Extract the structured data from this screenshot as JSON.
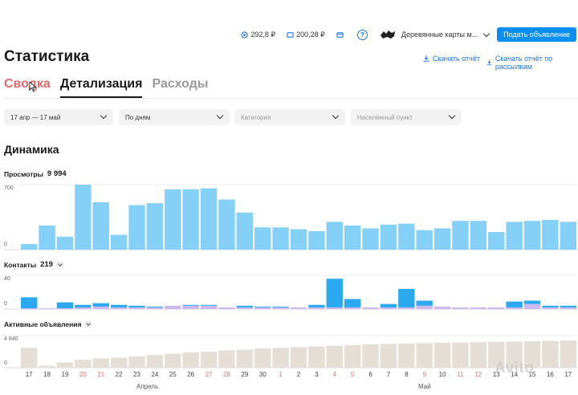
{
  "topbar": {
    "balance1": "292,8 ₽",
    "balance2": "200,28 ₽",
    "help": "?",
    "account_name": "Деревянные карты м...",
    "post_ad_label": "Подать объявление"
  },
  "page": {
    "title": "Статистика",
    "download_report": "Скачать отчёт",
    "download_report_mail": "Скачать отчёт по рассылкам",
    "tabs": [
      "Сводка",
      "Детализация",
      "Расходы"
    ]
  },
  "filters": {
    "date_range": "17 апр — 17 май",
    "grouping": "По дням",
    "category_placeholder": "Категория",
    "city_placeholder": "Населённый пункт"
  },
  "dynamics": {
    "title": "Динамика",
    "views_label": "Просмотры",
    "views_total": "9 994",
    "contacts_label": "Контакты",
    "contacts_total": "219",
    "active_label": "Активные объявления"
  },
  "chart_data": [
    {
      "type": "bar",
      "name": "views",
      "categories": [
        "17",
        "18",
        "19",
        "20",
        "21",
        "22",
        "23",
        "24",
        "25",
        "26",
        "27",
        "28",
        "29",
        "30",
        "1",
        "2",
        "3",
        "4",
        "5",
        "6",
        "7",
        "8",
        "9",
        "10",
        "11",
        "12",
        "13",
        "14",
        "15",
        "16",
        "17"
      ],
      "weekend_flags": [
        false,
        false,
        false,
        true,
        true,
        false,
        false,
        false,
        false,
        false,
        true,
        true,
        false,
        false,
        true,
        false,
        false,
        true,
        true,
        false,
        false,
        false,
        true,
        false,
        true,
        true,
        false,
        false,
        false,
        false,
        false
      ],
      "values": [
        60,
        260,
        140,
        700,
        510,
        160,
        480,
        500,
        650,
        650,
        660,
        540,
        400,
        240,
        240,
        220,
        200,
        300,
        260,
        230,
        270,
        280,
        210,
        230,
        310,
        310,
        190,
        300,
        310,
        320,
        300
      ],
      "ylim": [
        0,
        700
      ],
      "yticks": [
        "700",
        "0"
      ],
      "color": "#84d0f6"
    },
    {
      "type": "bar",
      "name": "contacts",
      "categories": [
        "17",
        "18",
        "19",
        "20",
        "21",
        "22",
        "23",
        "24",
        "25",
        "26",
        "27",
        "28",
        "29",
        "30",
        "1",
        "2",
        "3",
        "4",
        "5",
        "6",
        "7",
        "8",
        "9",
        "10",
        "11",
        "12",
        "13",
        "14",
        "15",
        "16",
        "17"
      ],
      "values": [
        13,
        0,
        7,
        3,
        4,
        3,
        2,
        1,
        0,
        1,
        1,
        0,
        2,
        1,
        1,
        0,
        3,
        34,
        10,
        0,
        4,
        22,
        6,
        0,
        0,
        0,
        0,
        7,
        4,
        2,
        2
      ],
      "secondary_values": [
        1,
        1,
        1,
        2,
        3,
        2,
        2,
        2,
        4,
        4,
        4,
        2,
        2,
        2,
        2,
        2,
        2,
        2,
        2,
        2,
        2,
        2,
        4,
        3,
        2,
        2,
        2,
        2,
        6,
        2,
        2
      ],
      "ylim": [
        0,
        40
      ],
      "yticks": [
        "40",
        "0"
      ],
      "colors": [
        "#2ba9f0",
        "#cbb8f0"
      ]
    },
    {
      "type": "bar",
      "name": "active_ads",
      "categories": [
        "17",
        "18",
        "19",
        "20",
        "21",
        "22",
        "23",
        "24",
        "25",
        "26",
        "27",
        "28",
        "29",
        "30",
        "1",
        "2",
        "3",
        "4",
        "5",
        "6",
        "7",
        "8",
        "9",
        "10",
        "11",
        "12",
        "13",
        "14",
        "15",
        "16",
        "17"
      ],
      "values": [
        3000,
        300,
        800,
        1200,
        1400,
        1500,
        1700,
        1900,
        2100,
        2300,
        2400,
        2600,
        2700,
        2900,
        3000,
        3100,
        3200,
        3300,
        3400,
        3500,
        3600,
        3650,
        3700,
        3750,
        3800,
        3850,
        3900,
        3950,
        4000,
        4050,
        4100
      ],
      "ylim": [
        0,
        4840
      ],
      "yticks": [
        "4 840",
        "0"
      ],
      "color": "#e4ded6"
    }
  ],
  "months": [
    "Апрель",
    "Май"
  ],
  "watermark": "Avito"
}
